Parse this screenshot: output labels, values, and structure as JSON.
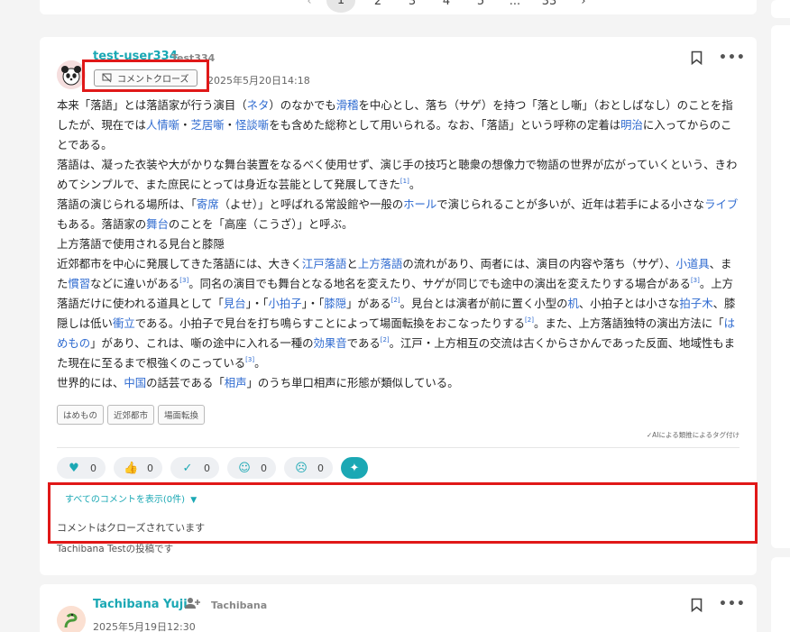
{
  "pagination": {
    "current": "1",
    "pages": [
      "2",
      "3",
      "4",
      "5",
      "...",
      "33"
    ],
    "prev": "‹",
    "next": "›"
  },
  "post": {
    "username": "test-user334",
    "user_id": "Test334",
    "date": "2025年5月20日14:18",
    "close_badge": "コメントクローズ",
    "paragraphs": [
      [
        {
          "t": "本来「落語」とは落語家が行う演目（"
        },
        {
          "t": "ネタ",
          "l": 1
        },
        {
          "t": "）のなかでも"
        },
        {
          "t": "滑稽",
          "l": 1
        },
        {
          "t": "を中心とし、落ち（サゲ）を持つ「落とし噺」（おとしばなし）のことを指したが、現在では"
        },
        {
          "t": "人情噺",
          "l": 1
        },
        {
          "t": "・"
        },
        {
          "t": "芝居噺",
          "l": 1
        },
        {
          "t": "・"
        },
        {
          "t": "怪談噺",
          "l": 1
        },
        {
          "t": "をも含めた総称として用いられる。なお、「落語」という呼称の定着は"
        },
        {
          "t": "明治",
          "l": 1
        },
        {
          "t": "に入ってからのことである。"
        }
      ],
      [
        {
          "t": "落語は、凝った衣装や大がかりな舞台装置をなるべく使用せず、演じ手の技巧と聴衆の想像力で物語の世界が広がっていくという、きわめてシンプルで、また庶民にとっては身近な芸能として発展してきた"
        },
        {
          "t": "[1]",
          "s": 1
        },
        {
          "t": "。"
        }
      ],
      [
        {
          "t": "落語の演じられる場所は、「"
        },
        {
          "t": "寄席",
          "l": 1
        },
        {
          "t": "（よせ）」と呼ばれる常設館や一般の"
        },
        {
          "t": "ホール",
          "l": 1
        },
        {
          "t": "で演じられることが多いが、近年は若手による小さな"
        },
        {
          "t": "ライブ",
          "l": 1
        },
        {
          "t": "もある。落語家の"
        },
        {
          "t": "舞台",
          "l": 1
        },
        {
          "t": "のことを「高座（こうざ）」と呼ぶ。"
        }
      ],
      [
        {
          "t": "上方落語で使用される見台と膝隠"
        }
      ],
      [
        {
          "t": "近郊都市を中心に発展してきた落語には、大きく"
        },
        {
          "t": "江戸落語",
          "l": 1
        },
        {
          "t": "と"
        },
        {
          "t": "上方落語",
          "l": 1
        },
        {
          "t": "の流れがあり、両者には、演目の内容や落ち（サゲ）、"
        },
        {
          "t": "小道具",
          "l": 1
        },
        {
          "t": "、また"
        },
        {
          "t": "慣習",
          "l": 1
        },
        {
          "t": "などに違いがある"
        },
        {
          "t": "[3]",
          "s": 1
        },
        {
          "t": "。同名の演目でも舞台となる地名を変えたり、サゲが同じでも途中の演出を変えたりする場合がある"
        },
        {
          "t": "[3]",
          "s": 1
        },
        {
          "t": "。上方落語だけに使われる道具として「"
        },
        {
          "t": "見台",
          "l": 1
        },
        {
          "t": "」・「"
        },
        {
          "t": "小拍子",
          "l": 1
        },
        {
          "t": "」・「"
        },
        {
          "t": "膝隠",
          "l": 1
        },
        {
          "t": "」がある"
        },
        {
          "t": "[2]",
          "s": 1
        },
        {
          "t": "。見台とは演者が前に置く小型の"
        },
        {
          "t": "机",
          "l": 1
        },
        {
          "t": "、小拍子とは小さな"
        },
        {
          "t": "拍子木",
          "l": 1
        },
        {
          "t": "、膝隠しは低い"
        },
        {
          "t": "衝立",
          "l": 1
        },
        {
          "t": "である。小拍子で見台を打ち鳴らすことによって場面転換をおこなったりする"
        },
        {
          "t": "[2]",
          "s": 1
        },
        {
          "t": "。また、上方落語独特の演出方法に「"
        },
        {
          "t": "はめもの",
          "l": 1
        },
        {
          "t": "」があり、これは、噺の途中に入れる一種の"
        },
        {
          "t": "効果音",
          "l": 1
        },
        {
          "t": "である"
        },
        {
          "t": "[2]",
          "s": 1
        },
        {
          "t": "。江戸・上方相互の交流は古くからさかんであった反面、地域性もまた現在に至るまで根強くのこっている"
        },
        {
          "t": "[3]",
          "s": 1
        },
        {
          "t": "。"
        }
      ],
      [
        {
          "t": "世界的には、"
        },
        {
          "t": "中国",
          "l": 1
        },
        {
          "t": "の話芸である「"
        },
        {
          "t": "相声",
          "l": 1
        },
        {
          "t": "」のうち単口相声に形態が類似している。"
        }
      ]
    ],
    "tags": [
      "はめもの",
      "近郊都市",
      "場面転換"
    ],
    "ai_note": "✓AIによる類推によるタグ付け",
    "reactions": [
      {
        "icon": "heart-icon",
        "glyph": "♥",
        "count": "0"
      },
      {
        "icon": "thumbs-up-icon",
        "glyph": "👍",
        "count": "0"
      },
      {
        "icon": "check-icon",
        "glyph": "✓",
        "count": "0"
      },
      {
        "icon": "smile-icon",
        "glyph": "☺",
        "count": "0"
      },
      {
        "icon": "surprised-icon",
        "glyph": "☹",
        "count": "0"
      }
    ],
    "show_all_comments": "すべてのコメントを表示(0件)",
    "comments_closed": "コメントはクローズされています",
    "owner_note": "Tachibana Testの投稿です"
  },
  "post2": {
    "username": "Tachibana Yuji",
    "user_id": "Tachibana",
    "date": "2025年5月19日12:30"
  },
  "colors": {
    "accent": "#1ba8b4",
    "link": "#2f6bd0",
    "highlight": "#e01818"
  }
}
